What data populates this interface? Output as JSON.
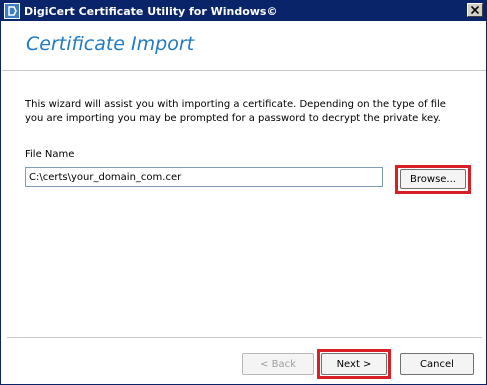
{
  "window": {
    "title": "DigiCert Certificate Utility for Windows©"
  },
  "header": {
    "title": "Certificate Import"
  },
  "body": {
    "description": "This wizard will assist you with importing a certificate.  Depending on the type of file you are importing you may be prompted for a password to decrypt the private key.",
    "file_label": "File Name",
    "file_value": "C:\\certs\\your_domain_com.cer",
    "browse_label": "Browse..."
  },
  "footer": {
    "back_label": "< Back",
    "next_label": "Next >",
    "cancel_label": "Cancel"
  },
  "colors": {
    "titlebar": "#0a246a",
    "header_title": "#1f7bc6",
    "highlight": "#d81f26"
  },
  "icons": {
    "app": "digicert-app-icon",
    "close": "close-icon"
  }
}
